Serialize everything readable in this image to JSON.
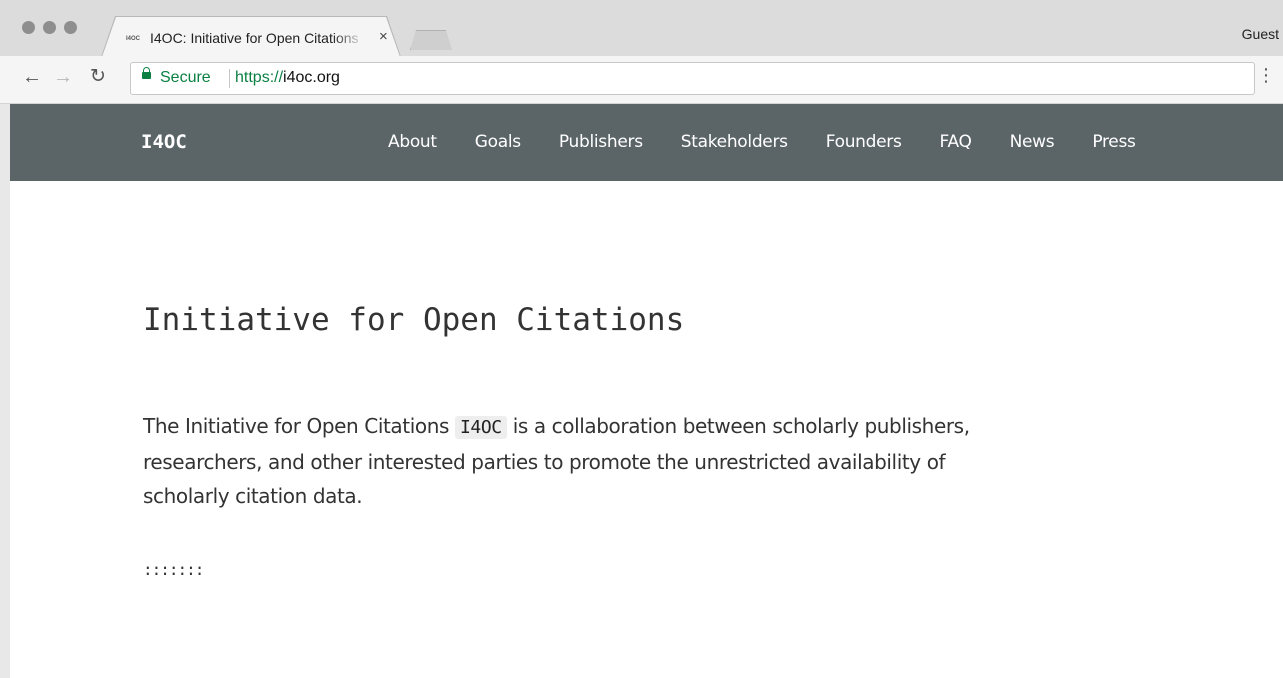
{
  "browser": {
    "tab_favicon_text": "I4OC",
    "tab_title": "I4OC: Initiative for Open Citations",
    "tab_close": "×",
    "profile": "Guest",
    "secure_label": "Secure",
    "url_scheme": "https://",
    "url_host": "i4oc.org",
    "menu_icon": "⋮"
  },
  "site_nav": {
    "brand": "I4OC",
    "links": [
      "About",
      "Goals",
      "Publishers",
      "Stakeholders",
      "Founders",
      "FAQ",
      "News",
      "Press"
    ]
  },
  "main": {
    "title": "Initiative for Open Citations",
    "intro_before": "The Initiative for Open Citations ",
    "intro_code": "I4OC",
    "intro_after": " is a collaboration between scholarly publishers, researchers, and other interested parties to promote the unrestricted availability of scholarly citation data.",
    "separator": ":::::::"
  },
  "colors": {
    "nav_background": "#5b6568",
    "secure_green": "#0b8043"
  }
}
